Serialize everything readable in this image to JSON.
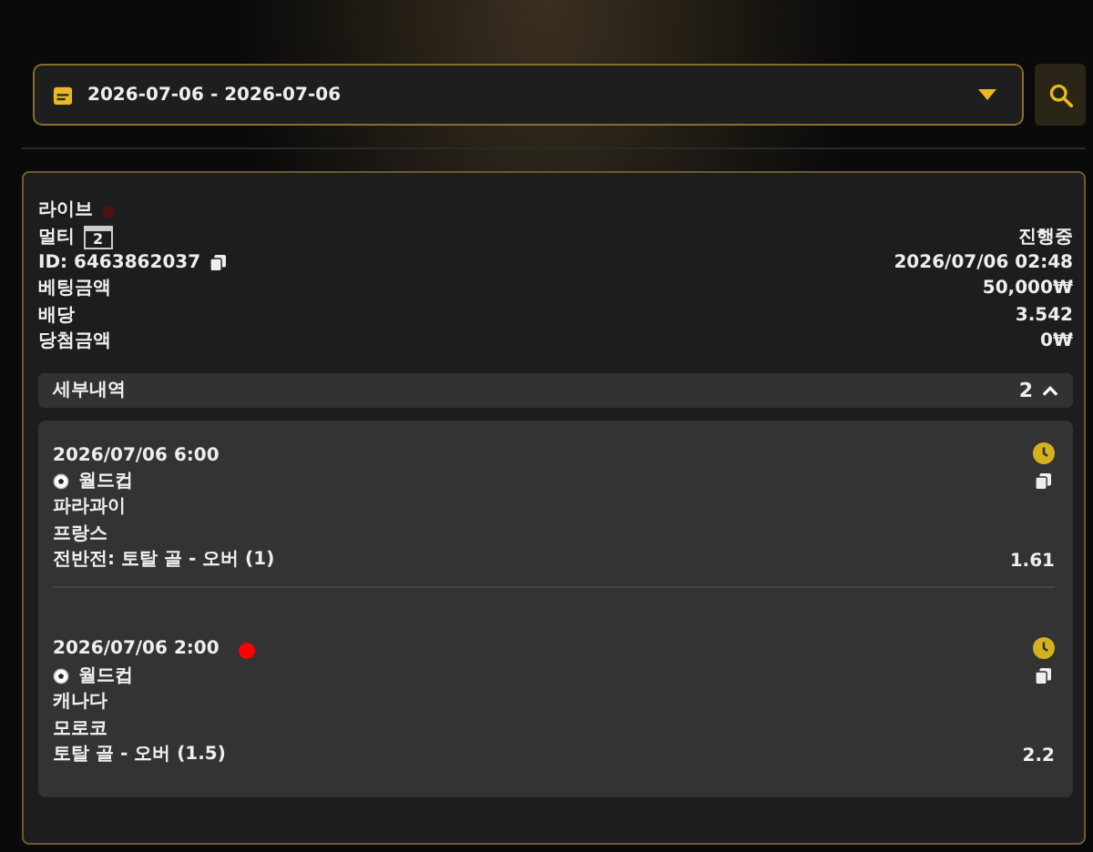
{
  "date_range": {
    "value": "2026-07-06 - 2026-07-06"
  },
  "bet": {
    "type": "라이브",
    "live": false,
    "mode": "멀티",
    "mode_count": "2",
    "status": "진행중",
    "id": "ID: 6463862037",
    "time": "2026/07/06 02:48",
    "rows": [
      {
        "label": "베팅금액",
        "value": "50,000₩"
      },
      {
        "label": "배당",
        "value": "3.542"
      },
      {
        "label": "당첨금액",
        "value": "0₩"
      }
    ]
  },
  "details": {
    "label": "세부내역",
    "count": "2",
    "expanded": true
  },
  "matches": [
    {
      "time": "2026/07/06 6:00",
      "live": false,
      "league": "월드컵",
      "home": "파라과이",
      "away": "프랑스",
      "market": "전반전: 토탈 골 - 오버 (1)",
      "odds": "1.61"
    },
    {
      "time": "2026/07/06 2:00",
      "live": true,
      "league": "월드컵",
      "home": "캐나다",
      "away": "모로코",
      "market": "토탈 골 - 오버 (1.5)",
      "odds": "2.2"
    }
  ]
}
